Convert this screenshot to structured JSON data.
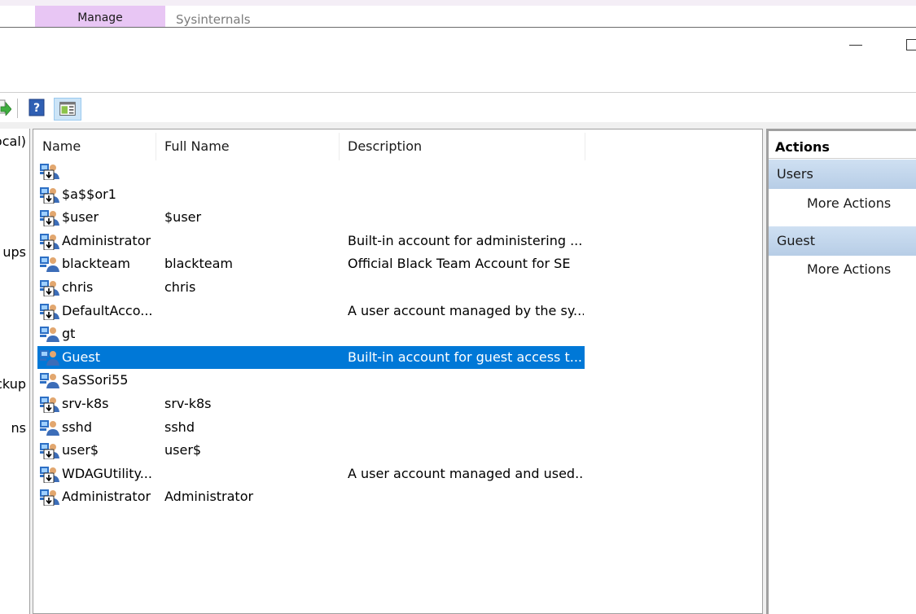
{
  "ribbon": {
    "tab_manage": "Manage",
    "tab_sysinternals": "Sysinternals"
  },
  "toolbar": {
    "icons": [
      "export-list-icon",
      "help-icon",
      "show-hide-action-pane-icon"
    ]
  },
  "tree": {
    "items": [
      "ocal)",
      "ups",
      "ckup",
      "ns"
    ]
  },
  "list": {
    "headers": {
      "name": "Name",
      "full_name": "Full Name",
      "description": "Description"
    },
    "rows": [
      {
        "name": "",
        "full_name": "",
        "description": "",
        "icon": "user-disabled-icon"
      },
      {
        "name": "$a$$or1",
        "full_name": "",
        "description": "",
        "icon": "user-disabled-icon"
      },
      {
        "name": "$user",
        "full_name": "$user",
        "description": "",
        "icon": "user-disabled-icon"
      },
      {
        "name": "Administrator",
        "full_name": "",
        "description": "Built-in account for administering ...",
        "icon": "user-disabled-icon"
      },
      {
        "name": "blackteam",
        "full_name": "blackteam",
        "description": "Official Black Team Account for SE",
        "icon": "user-icon"
      },
      {
        "name": "chris",
        "full_name": "chris",
        "description": "",
        "icon": "user-disabled-icon"
      },
      {
        "name": "DefaultAcco...",
        "full_name": "",
        "description": "A user account managed by the sy...",
        "icon": "user-disabled-icon"
      },
      {
        "name": "gt",
        "full_name": "",
        "description": "",
        "icon": "user-icon"
      },
      {
        "name": "Guest",
        "full_name": "",
        "description": "Built-in account for guest access t...",
        "icon": "user-icon",
        "selected": true
      },
      {
        "name": "SaSSori55",
        "full_name": "",
        "description": "",
        "icon": "user-icon"
      },
      {
        "name": "srv-k8s",
        "full_name": "srv-k8s",
        "description": "",
        "icon": "user-disabled-icon"
      },
      {
        "name": "sshd",
        "full_name": "sshd",
        "description": "",
        "icon": "user-icon"
      },
      {
        "name": "user$",
        "full_name": "user$",
        "description": "",
        "icon": "user-disabled-icon"
      },
      {
        "name": "WDAGUtility...",
        "full_name": "",
        "description": "A user account managed and used...",
        "icon": "user-disabled-icon"
      },
      {
        "name": "Administrator",
        "full_name": "Administrator",
        "description": "",
        "icon": "user-disabled-icon"
      }
    ]
  },
  "actions": {
    "title": "Actions",
    "groups": [
      {
        "label": "Users",
        "item": "More Actions"
      },
      {
        "label": "Guest",
        "item": "More Actions"
      }
    ]
  },
  "colors": {
    "selection": "#0078d7",
    "manage_tab": "#e8c6f4",
    "action_group": "#c4d7ec"
  }
}
